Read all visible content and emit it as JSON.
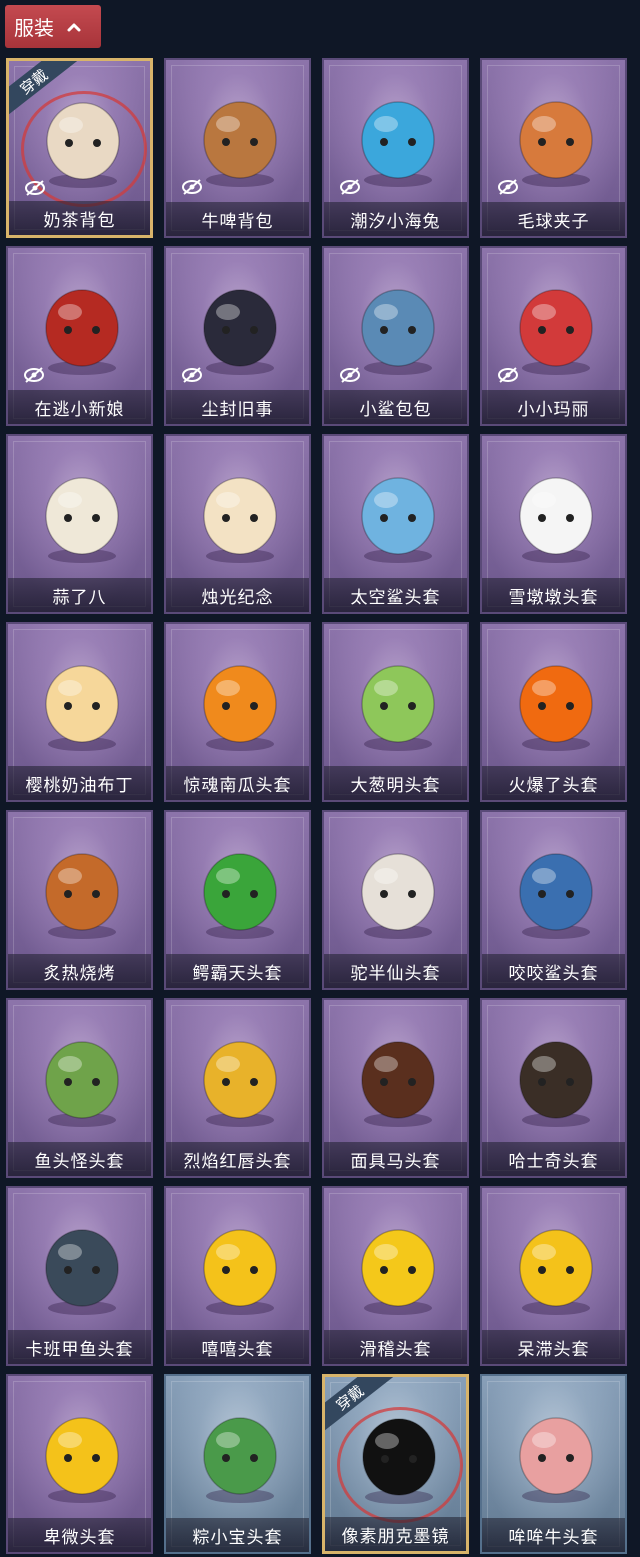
{
  "header": {
    "title": "服装"
  },
  "worn_badge": "穿戴",
  "colors": {
    "header_bg": "#b23c42",
    "page_bg": "#0f1726",
    "card_purple": "#7e68a0",
    "card_blue": "#7890aa",
    "worn_border": "#d8b46a"
  },
  "items": [
    {
      "label": "奶茶背包",
      "icon": "milk-tea-backpack-icon",
      "hidden_icon": true,
      "worn": true,
      "theme": "purple",
      "art_color": "#e9d9c4"
    },
    {
      "label": "牛啤背包",
      "icon": "cow-beer-backpack-icon",
      "hidden_icon": true,
      "worn": false,
      "theme": "purple",
      "art_color": "#b9773f"
    },
    {
      "label": "潮汐小海兔",
      "icon": "sea-bunny-icon",
      "hidden_icon": true,
      "worn": false,
      "theme": "purple",
      "art_color": "#3ba7dc"
    },
    {
      "label": "毛球夹子",
      "icon": "fluffy-clip-icon",
      "hidden_icon": true,
      "worn": false,
      "theme": "purple",
      "art_color": "#d77a3c"
    },
    {
      "label": "在逃小新娘",
      "icon": "runaway-bride-icon",
      "hidden_icon": true,
      "worn": false,
      "theme": "purple",
      "art_color": "#b52a22"
    },
    {
      "label": "尘封旧事",
      "icon": "sealed-past-icon",
      "hidden_icon": true,
      "worn": false,
      "theme": "purple",
      "art_color": "#2a2a3a"
    },
    {
      "label": "小鲨包包",
      "icon": "little-shark-bag-icon",
      "hidden_icon": true,
      "worn": false,
      "theme": "purple",
      "art_color": "#5a8ab5"
    },
    {
      "label": "小小玛丽",
      "icon": "little-mary-icon",
      "hidden_icon": true,
      "worn": false,
      "theme": "purple",
      "art_color": "#d23a3a"
    },
    {
      "label": "蒜了八",
      "icon": "garlic-head-icon",
      "hidden_icon": false,
      "worn": false,
      "theme": "purple",
      "art_color": "#efe8d8"
    },
    {
      "label": "烛光纪念",
      "icon": "candle-head-icon",
      "hidden_icon": false,
      "worn": false,
      "theme": "purple",
      "art_color": "#f3e2c4"
    },
    {
      "label": "太空鲨头套",
      "icon": "space-shark-helmet-icon",
      "hidden_icon": false,
      "worn": false,
      "theme": "purple",
      "art_color": "#6fb3e0"
    },
    {
      "label": "雪墩墩头套",
      "icon": "snowman-helmet-icon",
      "hidden_icon": false,
      "worn": false,
      "theme": "purple",
      "art_color": "#f5f5f5"
    },
    {
      "label": "樱桃奶油布丁",
      "icon": "cherry-pudding-icon",
      "hidden_icon": false,
      "worn": false,
      "theme": "purple",
      "art_color": "#f6d79a"
    },
    {
      "label": "惊魂南瓜头套",
      "icon": "pumpkin-helmet-icon",
      "hidden_icon": false,
      "worn": false,
      "theme": "purple",
      "art_color": "#f08a1c"
    },
    {
      "label": "大葱明头套",
      "icon": "scallion-helmet-icon",
      "hidden_icon": false,
      "worn": false,
      "theme": "purple",
      "art_color": "#8ec75a"
    },
    {
      "label": "火爆了头套",
      "icon": "fire-helmet-icon",
      "hidden_icon": false,
      "worn": false,
      "theme": "purple",
      "art_color": "#f06a10"
    },
    {
      "label": "炙热烧烤",
      "icon": "bbq-meat-icon",
      "hidden_icon": false,
      "worn": false,
      "theme": "purple",
      "art_color": "#c46a2a"
    },
    {
      "label": "鳄霸天头套",
      "icon": "crocodile-helmet-icon",
      "hidden_icon": false,
      "worn": false,
      "theme": "purple",
      "art_color": "#3aa53a"
    },
    {
      "label": "驼半仙头套",
      "icon": "alpaca-helmet-icon",
      "hidden_icon": false,
      "worn": false,
      "theme": "purple",
      "art_color": "#e6e0d8"
    },
    {
      "label": "咬咬鲨头套",
      "icon": "biting-shark-helmet-icon",
      "hidden_icon": false,
      "worn": false,
      "theme": "purple",
      "art_color": "#3a6fb0"
    },
    {
      "label": "鱼头怪头套",
      "icon": "fish-head-helmet-icon",
      "hidden_icon": false,
      "worn": false,
      "theme": "purple",
      "art_color": "#6fa34a"
    },
    {
      "label": "烈焰红唇头套",
      "icon": "red-lips-helmet-icon",
      "hidden_icon": false,
      "worn": false,
      "theme": "purple",
      "art_color": "#e8b22a"
    },
    {
      "label": "面具马头套",
      "icon": "horse-mask-icon",
      "hidden_icon": false,
      "worn": false,
      "theme": "purple",
      "art_color": "#5a2f1e"
    },
    {
      "label": "哈士奇头套",
      "icon": "husky-helmet-icon",
      "hidden_icon": false,
      "worn": false,
      "theme": "purple",
      "art_color": "#3a2e26"
    },
    {
      "label": "卡班甲鱼头套",
      "icon": "turtle-helmet-icon",
      "hidden_icon": false,
      "worn": false,
      "theme": "purple",
      "art_color": "#3a4a5a"
    },
    {
      "label": "嘻嘻头套",
      "icon": "grin-emoji-helmet-icon",
      "hidden_icon": false,
      "worn": false,
      "theme": "purple",
      "art_color": "#f4c21a"
    },
    {
      "label": "滑稽头套",
      "icon": "funny-emoji-helmet-icon",
      "hidden_icon": false,
      "worn": false,
      "theme": "purple",
      "art_color": "#f4c81a"
    },
    {
      "label": "呆滞头套",
      "icon": "dazed-emoji-helmet-icon",
      "hidden_icon": false,
      "worn": false,
      "theme": "purple",
      "art_color": "#f4c21a"
    },
    {
      "label": "卑微头套",
      "icon": "humble-emoji-helmet-icon",
      "hidden_icon": false,
      "worn": false,
      "theme": "purple",
      "art_color": "#f4c21a"
    },
    {
      "label": "粽小宝头套",
      "icon": "zongzi-helmet-icon",
      "hidden_icon": false,
      "worn": false,
      "theme": "blue",
      "art_color": "#4a9a4a"
    },
    {
      "label": "像素朋克墨镜",
      "icon": "pixel-sunglasses-icon",
      "hidden_icon": false,
      "worn": true,
      "theme": "blue",
      "art_color": "#111111"
    },
    {
      "label": "哞哞牛头套",
      "icon": "cow-helmet-icon",
      "hidden_icon": false,
      "worn": false,
      "theme": "blue",
      "art_color": "#e8a0a0"
    }
  ]
}
